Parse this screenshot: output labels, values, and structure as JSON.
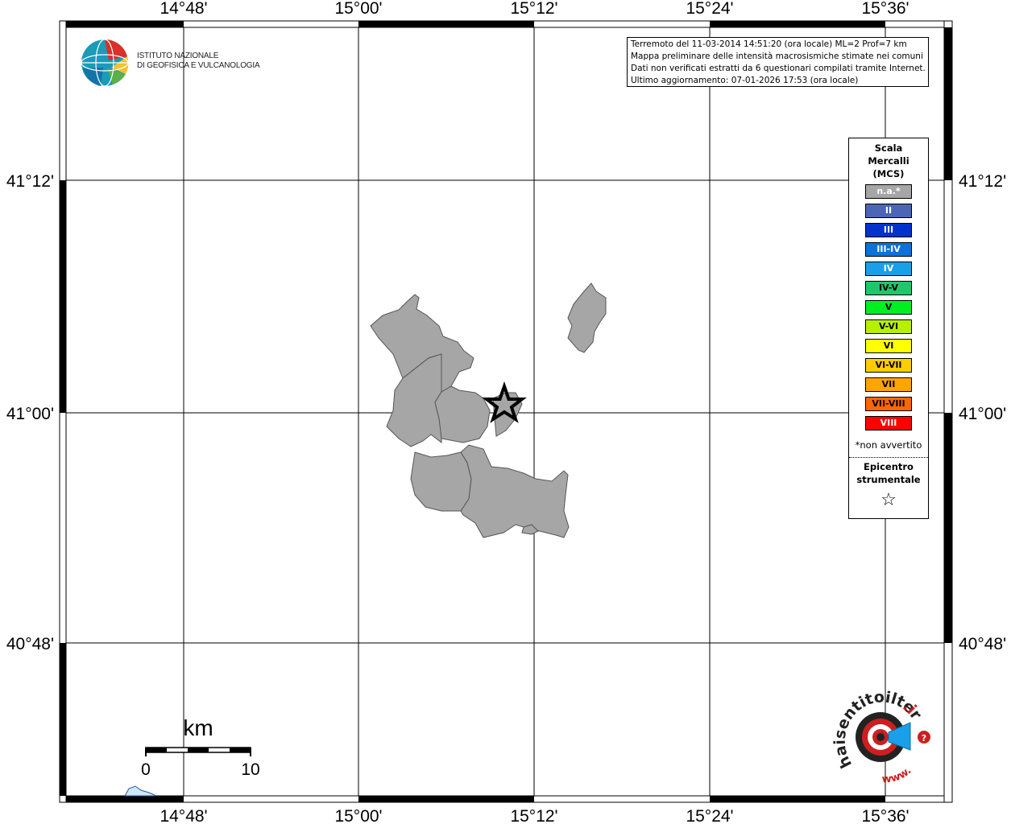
{
  "map": {
    "lon_ticks": [
      "14°48'",
      "15°00'",
      "15°12'",
      "15°24'",
      "15°36'"
    ],
    "lat_ticks": [
      "41°12'",
      "41°00'",
      "40°48'"
    ]
  },
  "logo": {
    "line1": "ISTITUTO NAZIONALE",
    "line2": "DI GEOFISICA E VULCANOLOGIA"
  },
  "info": {
    "line1": "Terremoto del 11-03-2014 14:51:20 (ora locale) ML=2 Prof=7 km",
    "line2": "Mappa preliminare delle intensità macrosismiche stimate nei comuni",
    "line3": "Dati non verificati estratti da 6 questionari compilati tramite Internet.",
    "line4": "Ultimo aggiornamento: 07-01-2026 17:53 (ora locale)"
  },
  "legend": {
    "title_line1": "Scala",
    "title_line2": "Mercalli",
    "title_line3": "(MCS)",
    "items": [
      {
        "label": "n.a.*",
        "color": "#a6a6a6",
        "text": "#ffffff"
      },
      {
        "label": "II",
        "color": "#4c66b5",
        "text": "#ffffff"
      },
      {
        "label": "III",
        "color": "#0033cc",
        "text": "#ffffff"
      },
      {
        "label": "III-IV",
        "color": "#0a72d8",
        "text": "#ffffff"
      },
      {
        "label": "IV",
        "color": "#1aa0e8",
        "text": "#ffffff"
      },
      {
        "label": "IV-V",
        "color": "#1ec86a",
        "text": "#000000"
      },
      {
        "label": "V",
        "color": "#00ee22",
        "text": "#000000"
      },
      {
        "label": "V-VI",
        "color": "#b6f000",
        "text": "#000000"
      },
      {
        "label": "VI",
        "color": "#ffff00",
        "text": "#000000"
      },
      {
        "label": "VI-VII",
        "color": "#ffcc00",
        "text": "#000000"
      },
      {
        "label": "VII",
        "color": "#ffa500",
        "text": "#000000"
      },
      {
        "label": "VII-VIII",
        "color": "#ff6600",
        "text": "#000000"
      },
      {
        "label": "VIII",
        "color": "#ff0000",
        "text": "#ffffff"
      }
    ],
    "note": "*non avvertito",
    "epicenter_line1": "Epicentro",
    "epicenter_line2": "strumentale",
    "star": "☆"
  },
  "scale_bar": {
    "unit": "km",
    "start": "0",
    "end": "10"
  },
  "badge": {
    "text_left": "haisentitoilterremoto",
    "tld": ".it",
    "www": "www.",
    "icon": "megaphone-icon"
  },
  "municipality_color": "#a6a6a6"
}
